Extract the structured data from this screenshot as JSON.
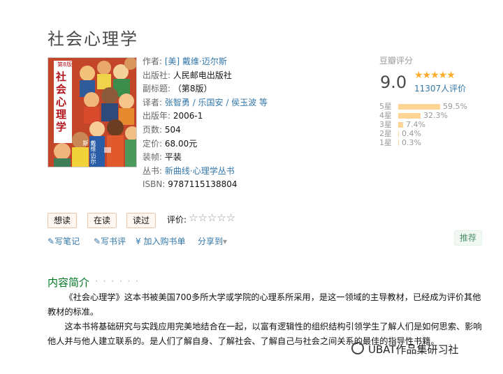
{
  "book": {
    "title": "社会心理学",
    "cover": {
      "title_chars": [
        "社",
        "会",
        "心",
        "理",
        "学"
      ],
      "edition": "第8版",
      "author": "戴维·迈尔斯"
    }
  },
  "info": {
    "author_label": "作者:",
    "author_value": "[美] 戴维·迈尔斯",
    "publisher_label": "出版社:",
    "publisher_value": "人民邮电出版社",
    "subtitle_label": "副标题:",
    "subtitle_value": "（第8版）",
    "translator_label": "译者:",
    "translator_value": "张智勇 / 乐国安 / 侯玉波 等",
    "year_label": "出版年:",
    "year_value": "2006-1",
    "pages_label": "页数:",
    "pages_value": "504",
    "price_label": "定价:",
    "price_value": "68.00元",
    "binding_label": "装帧:",
    "binding_value": "平装",
    "series_label": "丛书:",
    "series_value": "新曲线·心理学丛书",
    "isbn_label": "ISBN:",
    "isbn_value": "9787115138804"
  },
  "rating": {
    "label": "豆瓣评分",
    "score": "9.0",
    "stars": "★★★★★",
    "votes": "11307人评价",
    "distribution": [
      {
        "label": "5星",
        "pct": "59.5%",
        "value": 0.595
      },
      {
        "label": "4星",
        "pct": "32.3%",
        "value": 0.323
      },
      {
        "label": "3星",
        "pct": "7.4%",
        "value": 0.074
      },
      {
        "label": "2星",
        "pct": "0.4%",
        "value": 0.004
      },
      {
        "label": "1星",
        "pct": "0.3%",
        "value": 0.003
      }
    ]
  },
  "actions": {
    "want_read": "想读",
    "reading": "在读",
    "read": "读过",
    "my_rating_label": "评价:",
    "my_rating_stars": "☆☆☆☆☆",
    "write_note": "写笔记",
    "write_review": "写书评",
    "add_to_cart": "加入购书单",
    "share": "分享到",
    "share_arrow": "▾",
    "recommend": "推荐"
  },
  "intro": {
    "title": "内容简介",
    "dots": "· · · · · ·",
    "p1": "《社会心理学》这本书被美国700多所大学或学院的心理系所采用，是这一领域的主导教材，已经成为评价其他教材的标准。",
    "p2": "这本书将基础研究与实践应用完美地结合在一起，以富有逻辑性的组织结构引领学生了解人们是如何思索、影响他人并与他人建立联系的。是人们了解自身、了解社会、了解自己与社会之间关系的最佳的指导性书籍。"
  },
  "watermark": "UBAT作品集研习社",
  "colors": {
    "link": "#3377aa",
    "section_title": "#007722",
    "star": "#ffac2d",
    "bar": "#ffd596"
  }
}
